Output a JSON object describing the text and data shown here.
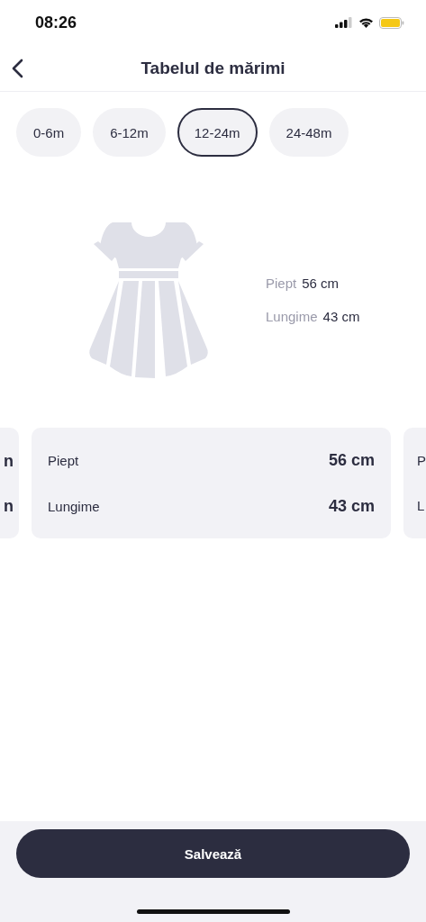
{
  "status_bar": {
    "time": "08:26"
  },
  "header": {
    "title": "Tabelul de mărimi"
  },
  "sizes": [
    {
      "label": "0-6m",
      "selected": false
    },
    {
      "label": "6-12m",
      "selected": false
    },
    {
      "label": "12-24m",
      "selected": true
    },
    {
      "label": "24-48m",
      "selected": false
    }
  ],
  "measurements": [
    {
      "label": "Piept",
      "value": "56 cm"
    },
    {
      "label": "Lungime",
      "value": "43 cm"
    }
  ],
  "cards": [
    {
      "kind": "peek_left",
      "rows": [
        {
          "value": "n"
        },
        {
          "value": "n"
        }
      ]
    },
    {
      "kind": "full",
      "rows": [
        {
          "label": "Piept",
          "value": "56 cm"
        },
        {
          "label": "Lungime",
          "value": "43 cm"
        }
      ]
    },
    {
      "kind": "peek_right",
      "rows": [
        {
          "label": "P"
        },
        {
          "label": "L"
        }
      ]
    }
  ],
  "save_button": "Salvează"
}
